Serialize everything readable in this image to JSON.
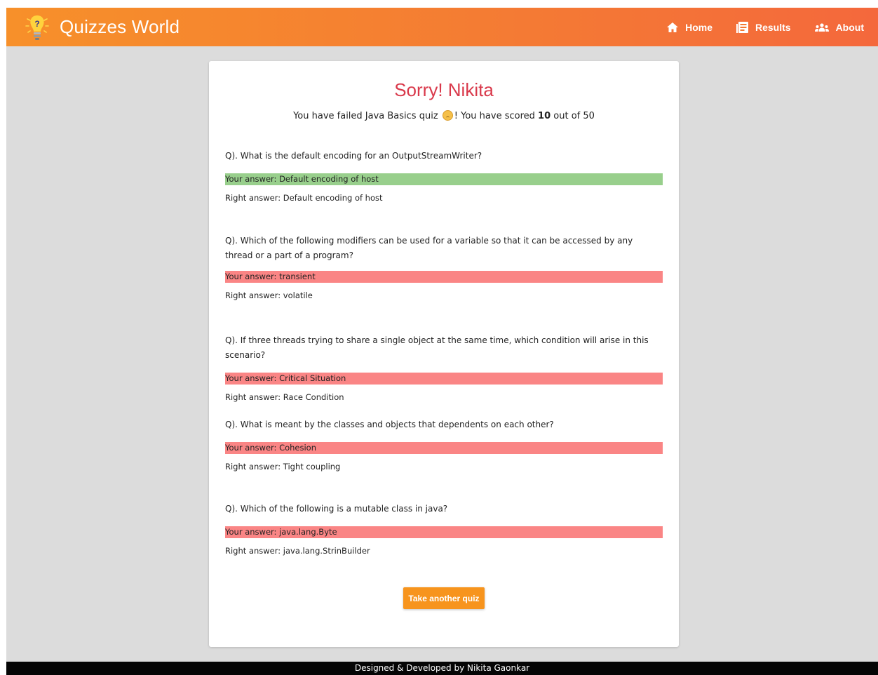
{
  "brand": {
    "title": "Quizzes World"
  },
  "nav": {
    "items": [
      {
        "label": "Home",
        "icon": "home-icon"
      },
      {
        "label": "Results",
        "icon": "results-icon"
      },
      {
        "label": "About",
        "icon": "people-icon"
      }
    ]
  },
  "result": {
    "title": "Sorry! Nikita",
    "sub_before": "You have failed Java Basics quiz",
    "sub_after": "!   You have scored",
    "score": "10",
    "sub_end": "out of 50"
  },
  "questions": [
    {
      "question": "Q). What is the default encoding for an OutputStreamWriter?",
      "your_answer": "Your answer: Default encoding of host",
      "right_answer": "Right answer: Default encoding of host",
      "status": "correct"
    },
    {
      "question": "Q). Which of the following modifiers can be used for a variable so that it can be accessed by any thread or a part of a program?",
      "your_answer": "Your answer: transient",
      "right_answer": "Right answer: volatile",
      "status": "wrong"
    },
    {
      "question": "Q). If three threads trying to share a single object at the same time, which condition will arise in this scenario?",
      "your_answer": "Your answer: Critical Situation",
      "right_answer": "Right answer: Race Condition",
      "status": "wrong"
    },
    {
      "question": "Q). What is meant by the classes and objects that dependents on each other?",
      "your_answer": "Your answer: Cohesion",
      "right_answer": "Right answer: Tight coupling",
      "status": "wrong"
    },
    {
      "question": "Q). Which of the following is a mutable class in java?",
      "your_answer": "Your answer: java.lang.Byte",
      "right_answer": "Right answer: java.lang.StrinBuilder",
      "status": "wrong"
    }
  ],
  "actions": {
    "take_another": "Take another quiz"
  },
  "footer": {
    "text": "Designed & Developed by Nikita Gaonkar"
  },
  "colors": {
    "header_start": "#f7902a",
    "header_end": "#f4683c",
    "title_red": "#d9394b",
    "correct_bg": "#98cf8c",
    "wrong_bg": "#fa8585",
    "button": "#f7941d"
  }
}
